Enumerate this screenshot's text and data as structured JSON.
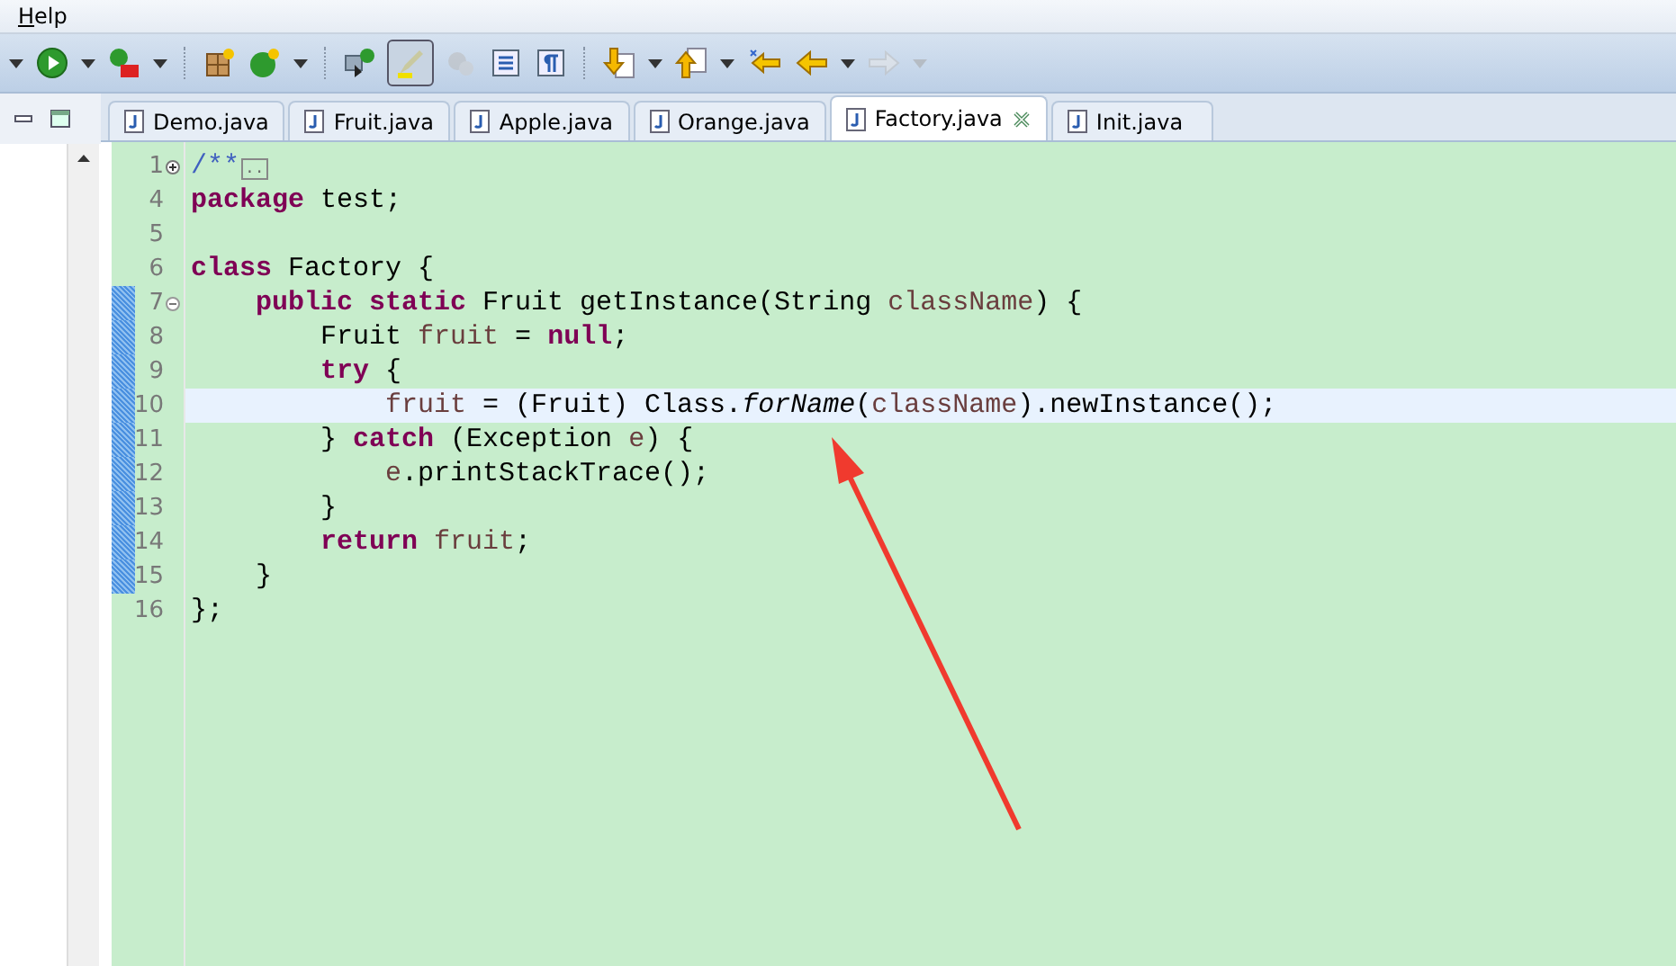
{
  "menu": [
    {
      "label": "Help"
    }
  ],
  "toolbar": [
    {
      "items": [
        {
          "kind": "caret",
          "disabled": false,
          "selected": false
        },
        {
          "kind": "run",
          "disabled": false,
          "selected": false
        },
        {
          "kind": "caret",
          "disabled": false,
          "selected": false
        },
        {
          "kind": "debug-tool",
          "disabled": false,
          "selected": false
        },
        {
          "kind": "caret",
          "disabled": false,
          "selected": false
        }
      ]
    },
    {
      "items": [
        {
          "kind": "new-package",
          "disabled": false,
          "selected": false
        },
        {
          "kind": "new-class",
          "disabled": false,
          "selected": false
        },
        {
          "kind": "caret",
          "disabled": false,
          "selected": false
        }
      ]
    },
    {
      "items": [
        {
          "kind": "open-type",
          "disabled": false,
          "selected": false
        },
        {
          "kind": "highlight",
          "disabled": false,
          "selected": true
        },
        {
          "kind": "toggle-mark",
          "disabled": true,
          "selected": false
        },
        {
          "kind": "block",
          "disabled": false,
          "selected": false
        },
        {
          "kind": "pilcrow",
          "disabled": false,
          "selected": false
        }
      ]
    },
    {
      "items": [
        {
          "kind": "next-annotation",
          "disabled": false,
          "selected": false
        },
        {
          "kind": "caret",
          "disabled": false,
          "selected": false
        },
        {
          "kind": "prev-annotation",
          "disabled": false,
          "selected": false
        },
        {
          "kind": "caret",
          "disabled": false,
          "selected": false
        },
        {
          "kind": "last-edit",
          "disabled": false,
          "selected": false
        },
        {
          "kind": "back",
          "disabled": false,
          "selected": false
        },
        {
          "kind": "caret",
          "disabled": false,
          "selected": false
        },
        {
          "kind": "forward",
          "disabled": true,
          "selected": false
        },
        {
          "kind": "caret",
          "disabled": true,
          "selected": false
        }
      ]
    }
  ],
  "tabs": [
    {
      "label": "Demo.java",
      "selected": false
    },
    {
      "label": "Fruit.java",
      "selected": false
    },
    {
      "label": "Apple.java",
      "selected": false
    },
    {
      "label": "Orange.java",
      "selected": false
    },
    {
      "label": "Factory.java",
      "selected": true
    },
    {
      "label": "Init.java",
      "selected": false
    }
  ],
  "editor": {
    "lines": [
      {
        "number": "1",
        "foldable": true,
        "collapsed": true,
        "changed": false,
        "current": false,
        "tokens": [
          {
            "text": "/**",
            "kind": "comment"
          },
          {
            "text": "..",
            "kind": "folded"
          }
        ]
      },
      {
        "number": "4",
        "foldable": false,
        "changed": false,
        "current": false,
        "tokens": [
          {
            "text": "package",
            "kind": "keyword"
          },
          {
            "text": " test;",
            "kind": "plain"
          }
        ]
      },
      {
        "number": "5",
        "foldable": false,
        "changed": false,
        "current": false
      },
      {
        "number": "6",
        "foldable": false,
        "changed": false,
        "current": false,
        "tokens": [
          {
            "text": "class",
            "kind": "keyword"
          },
          {
            "text": " Factory {",
            "kind": "plain"
          }
        ]
      },
      {
        "number": "7",
        "foldable": true,
        "collapsed": false,
        "changed": true,
        "current": false,
        "tokens": [
          {
            "text": "    public",
            "kind": "keyword"
          },
          {
            "text": " static",
            "kind": "keyword"
          },
          {
            "text": " Fruit getInstance(String ",
            "kind": "plain"
          },
          {
            "text": "className",
            "kind": "variable"
          },
          {
            "text": ") {",
            "kind": "plain"
          }
        ]
      },
      {
        "number": "8",
        "foldable": false,
        "changed": true,
        "current": false,
        "tokens": [
          {
            "text": "        Fruit ",
            "kind": "plain"
          },
          {
            "text": "fruit",
            "kind": "variable"
          },
          {
            "text": " = ",
            "kind": "plain"
          },
          {
            "text": "null",
            "kind": "keyword"
          },
          {
            "text": ";",
            "kind": "plain"
          }
        ]
      },
      {
        "number": "9",
        "foldable": false,
        "changed": true,
        "current": false,
        "tokens": [
          {
            "text": "        try",
            "kind": "keyword"
          },
          {
            "text": " {",
            "kind": "plain"
          }
        ]
      },
      {
        "number": "10",
        "foldable": false,
        "changed": true,
        "current": true,
        "tokens": [
          {
            "text": "            fruit",
            "kind": "variable"
          },
          {
            "text": " = (Fruit) Class.",
            "kind": "plain"
          },
          {
            "text": "forName",
            "kind": "static"
          },
          {
            "text": "(",
            "kind": "plain"
          },
          {
            "text": "className",
            "kind": "variable"
          },
          {
            "text": ").newInstance();",
            "kind": "plain"
          }
        ]
      },
      {
        "number": "11",
        "foldable": false,
        "changed": true,
        "current": false,
        "tokens": [
          {
            "text": "        } ",
            "kind": "plain"
          },
          {
            "text": "catch",
            "kind": "keyword"
          },
          {
            "text": " (Exception ",
            "kind": "plain"
          },
          {
            "text": "e",
            "kind": "variable"
          },
          {
            "text": ") {",
            "kind": "plain"
          }
        ]
      },
      {
        "number": "12",
        "foldable": false,
        "changed": true,
        "current": false,
        "tokens": [
          {
            "text": "            e",
            "kind": "variable"
          },
          {
            "text": ".printStackTrace();",
            "kind": "plain"
          }
        ]
      },
      {
        "number": "13",
        "foldable": false,
        "changed": true,
        "current": false,
        "tokens": [
          {
            "text": "        }",
            "kind": "plain"
          }
        ]
      },
      {
        "number": "14",
        "foldable": false,
        "changed": true,
        "current": false,
        "tokens": [
          {
            "text": "        return",
            "kind": "keyword"
          },
          {
            "text": " fruit",
            "kind": "variable"
          },
          {
            "text": ";",
            "kind": "plain"
          }
        ]
      },
      {
        "number": "15",
        "foldable": false,
        "changed": true,
        "current": false,
        "tokens": [
          {
            "text": "    }",
            "kind": "plain"
          }
        ]
      },
      {
        "number": "16",
        "foldable": false,
        "changed": false,
        "current": false,
        "tokens": [
          {
            "text": "};",
            "kind": "plain"
          }
        ]
      }
    ]
  }
}
